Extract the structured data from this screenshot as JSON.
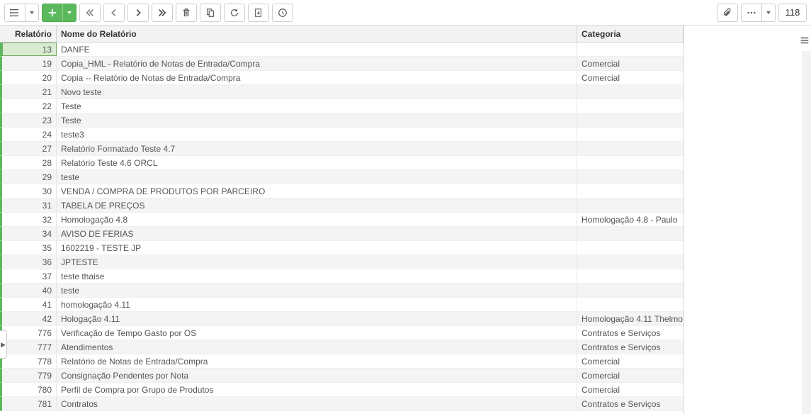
{
  "toolbar": {
    "record_count": "118"
  },
  "columns": {
    "id": "Relatório",
    "name": "Nome do Relatório",
    "category": "Categoria"
  },
  "rows": [
    {
      "id": "13",
      "name": "DANFE",
      "category": "",
      "selected": true
    },
    {
      "id": "19",
      "name": "Copia_HML - Relatório de Notas de Entrada/Compra",
      "category": "Comercial"
    },
    {
      "id": "20",
      "name": "Copia -- Relatório de Notas de Entrada/Compra",
      "category": "Comercial"
    },
    {
      "id": "21",
      "name": "Novo teste",
      "category": ""
    },
    {
      "id": "22",
      "name": "Teste",
      "category": ""
    },
    {
      "id": "23",
      "name": "Teste",
      "category": ""
    },
    {
      "id": "24",
      "name": "teste3",
      "category": ""
    },
    {
      "id": "27",
      "name": "Relatório Formatado Teste 4.7",
      "category": ""
    },
    {
      "id": "28",
      "name": "Relatório Teste 4.6 ORCL",
      "category": ""
    },
    {
      "id": "29",
      "name": "teste",
      "category": ""
    },
    {
      "id": "30",
      "name": "VENDA / COMPRA DE PRODUTOS POR PARCEIRO",
      "category": ""
    },
    {
      "id": "31",
      "name": "TABELA DE PREÇOS",
      "category": ""
    },
    {
      "id": "32",
      "name": "Homologação 4.8",
      "category": "Homologação 4.8 - Paulo"
    },
    {
      "id": "34",
      "name": "AVISO DE FERIAS",
      "category": ""
    },
    {
      "id": "35",
      "name": "1602219 - TESTE JP",
      "category": ""
    },
    {
      "id": "36",
      "name": "JPTESTE",
      "category": ""
    },
    {
      "id": "37",
      "name": "teste thaise",
      "category": ""
    },
    {
      "id": "40",
      "name": "teste",
      "category": ""
    },
    {
      "id": "41",
      "name": "homologação 4.11",
      "category": ""
    },
    {
      "id": "42",
      "name": "Hologação 4.11",
      "category": "Homologação 4.11 Thelmo"
    },
    {
      "id": "776",
      "name": "Verificação de Tempo Gasto por OS",
      "category": "Contratos e Serviços"
    },
    {
      "id": "777",
      "name": "Atendimentos",
      "category": "Contratos e Serviços"
    },
    {
      "id": "778",
      "name": "Relatório de Notas de Entrada/Compra",
      "category": "Comercial"
    },
    {
      "id": "779",
      "name": "Consignação Pendentes por Nota",
      "category": "Comercial"
    },
    {
      "id": "780",
      "name": "Perfil de Compra por Grupo de Produtos",
      "category": "Comercial"
    },
    {
      "id": "781",
      "name": "Contratos",
      "category": "Contratos e Serviços"
    }
  ]
}
